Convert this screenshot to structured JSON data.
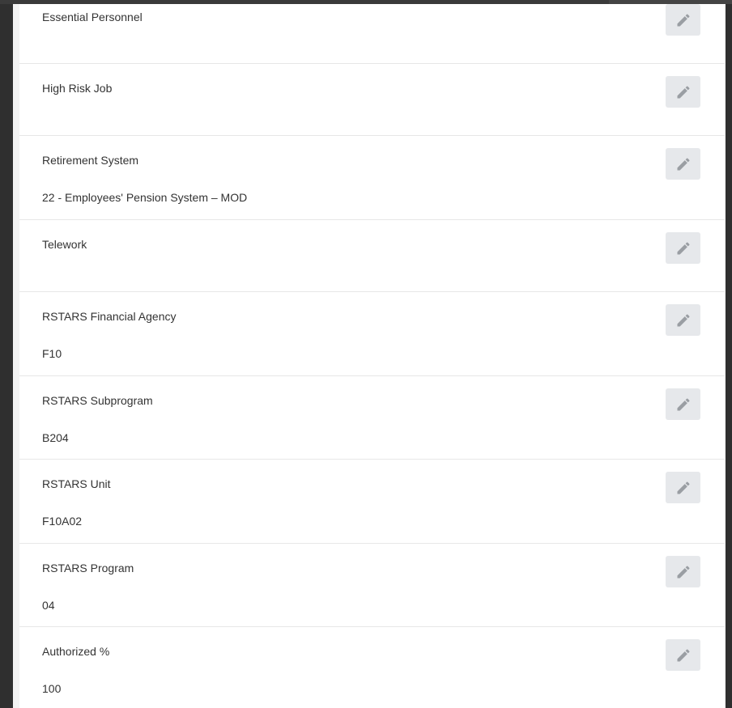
{
  "fields": [
    {
      "label": "Essential Personnel",
      "value": ""
    },
    {
      "label": "High Risk Job",
      "value": ""
    },
    {
      "label": "Retirement System",
      "value": "22 - Employees' Pension System – MOD"
    },
    {
      "label": "Telework",
      "value": ""
    },
    {
      "label": "RSTARS Financial Agency",
      "value": "F10"
    },
    {
      "label": "RSTARS Subprogram",
      "value": "B204"
    },
    {
      "label": "RSTARS Unit",
      "value": "F10A02"
    },
    {
      "label": "RSTARS Program",
      "value": "04"
    },
    {
      "label": "Authorized %",
      "value": "100"
    }
  ],
  "icons": {
    "edit": "pencil-icon"
  },
  "colors": {
    "background": "#2f2f2f",
    "card": "#ffffff",
    "divider": "#e7e7e7",
    "edit_button": "#e6e8eb",
    "edit_icon": "#9a9ea3",
    "text": "#333333"
  }
}
